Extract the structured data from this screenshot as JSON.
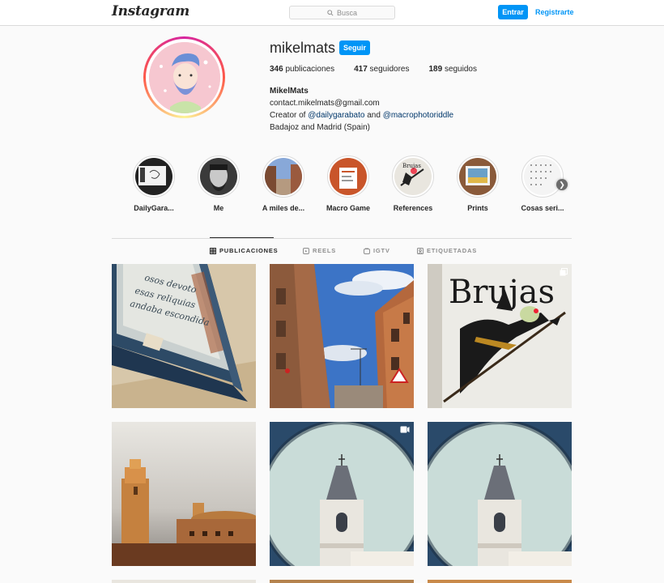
{
  "header": {
    "logo": "Instagram",
    "search_placeholder": "Busca",
    "login_label": "Entrar",
    "register_label": "Registrarte"
  },
  "profile": {
    "username": "mikelmats",
    "follow_label": "Seguir",
    "stats": [
      {
        "value": "346",
        "label": "publicaciones"
      },
      {
        "value": "417",
        "label": "seguidores"
      },
      {
        "value": "189",
        "label": "seguidos"
      }
    ],
    "bio": {
      "name": "MikelMats",
      "email": "contact.mikelmats@gmail.com",
      "creator_prefix": "Creator of ",
      "tag1": "@dailygarabato",
      "and": " and ",
      "tag2": "@macrophotoriddle",
      "location": "Badajoz and Madrid (Spain)"
    }
  },
  "highlights": [
    {
      "label": "DailyGara..."
    },
    {
      "label": "Me"
    },
    {
      "label": "A miles de..."
    },
    {
      "label": "Macro Game"
    },
    {
      "label": "References"
    },
    {
      "label": "Prints"
    },
    {
      "label": "Cosas seri..."
    }
  ],
  "tabs": [
    {
      "label": "PUBLICACIONES",
      "active": true
    },
    {
      "label": "REELS"
    },
    {
      "label": "IGTV"
    },
    {
      "label": "ETIQUETADAS"
    }
  ],
  "posts": [
    {
      "subject": "weathered blue window frame with sign",
      "sign_lines": [
        "osos devoto",
        "esas reliquias",
        "andaba escondida"
      ]
    },
    {
      "subject": "street with brick buildings and cranes"
    },
    {
      "subject": "brujas mural with witch on broom",
      "mural_text": "Brujas",
      "type_icon": "carousel-icon"
    },
    {
      "subject": "church towers at sunset"
    },
    {
      "subject": "church tower through lens",
      "type_icon": "video-icon"
    },
    {
      "subject": "church tower through lens"
    }
  ],
  "colors": {
    "accent": "#0095f6",
    "tag": "#00376b",
    "border": "#dbdbdb",
    "muted": "#8e8e8e"
  }
}
